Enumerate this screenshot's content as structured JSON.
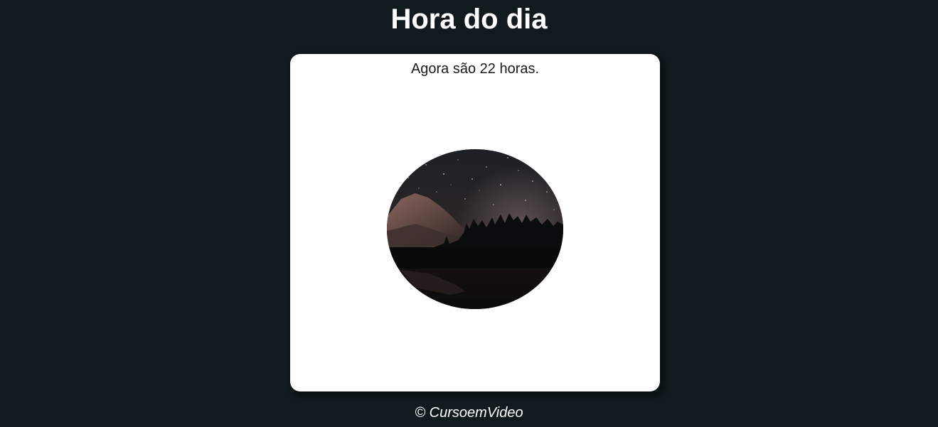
{
  "header": {
    "title": "Hora do dia"
  },
  "card": {
    "message": "Agora são 22 horas.",
    "image": {
      "subject": "night-landscape-photo"
    }
  },
  "footer": {
    "text": "© CursoemVideo"
  }
}
